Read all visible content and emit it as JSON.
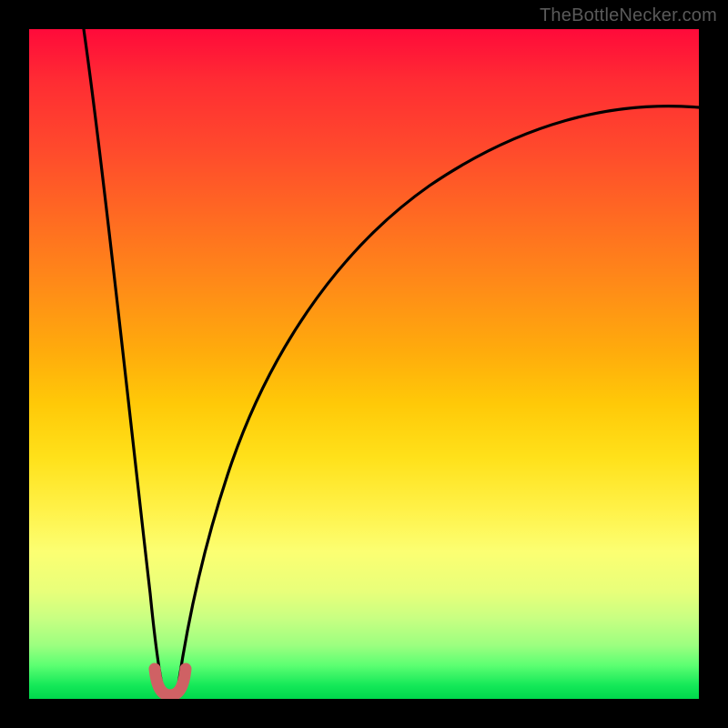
{
  "watermark": {
    "text": "TheBottleNecker.com"
  },
  "chart_data": {
    "type": "line",
    "title": "",
    "xlabel": "",
    "ylabel": "",
    "xlim": [
      0,
      100
    ],
    "ylim": [
      0,
      100
    ],
    "annotations": [],
    "series": [
      {
        "name": "left-curve",
        "x": [
          8,
          10,
          12,
          14,
          16,
          18,
          19
        ],
        "values": [
          100,
          78,
          56,
          36,
          18,
          5,
          2
        ]
      },
      {
        "name": "right-curve",
        "x": [
          21,
          23,
          26,
          30,
          36,
          44,
          54,
          66,
          80,
          92,
          100
        ],
        "values": [
          2,
          8,
          20,
          34,
          48,
          59,
          68,
          75,
          81,
          85,
          88
        ]
      },
      {
        "name": "valley-marker",
        "x": [
          18,
          19,
          20,
          21,
          22
        ],
        "values": [
          4,
          1.5,
          1,
          1.5,
          4
        ]
      }
    ],
    "colors": {
      "gradient_top": "#ff0a3a",
      "gradient_bottom": "#00d84c",
      "curve": "#000000",
      "marker": "#c85a5a",
      "background": "#000000",
      "watermark": "#5a5a5a"
    }
  }
}
